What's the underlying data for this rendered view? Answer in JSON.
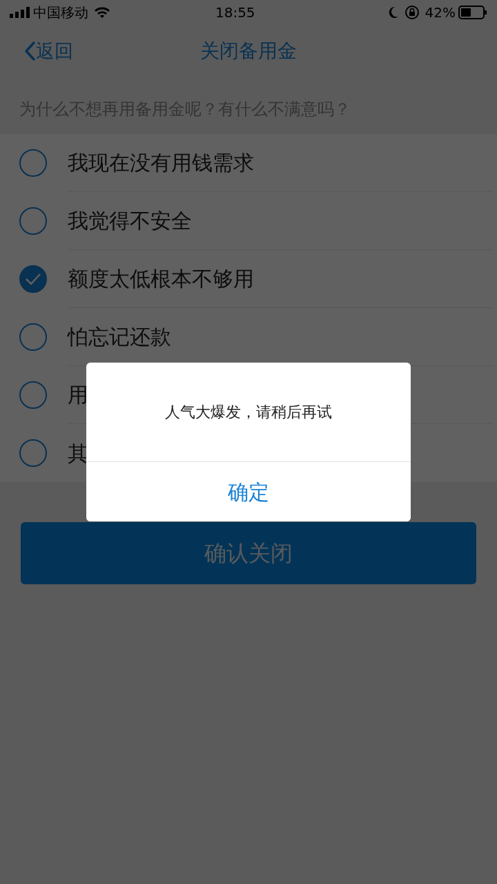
{
  "status_bar": {
    "carrier": "中国移动",
    "time": "18:55",
    "battery": "42%"
  },
  "nav": {
    "back": "返回",
    "title": "关闭备用金"
  },
  "question": "为什么不想再用备用金呢？有什么不满意吗？",
  "options": [
    {
      "label": "我现在没有用钱需求",
      "selected": false
    },
    {
      "label": "我觉得不安全",
      "selected": false
    },
    {
      "label": "额度太低根本不够用",
      "selected": true
    },
    {
      "label": "怕忘记还款",
      "selected": false
    },
    {
      "label": "用",
      "selected": false
    },
    {
      "label": "其",
      "selected": false
    }
  ],
  "confirm_button": "确认关闭",
  "dialog": {
    "message": "人气大爆发，请稍后再试",
    "button": "确定"
  }
}
